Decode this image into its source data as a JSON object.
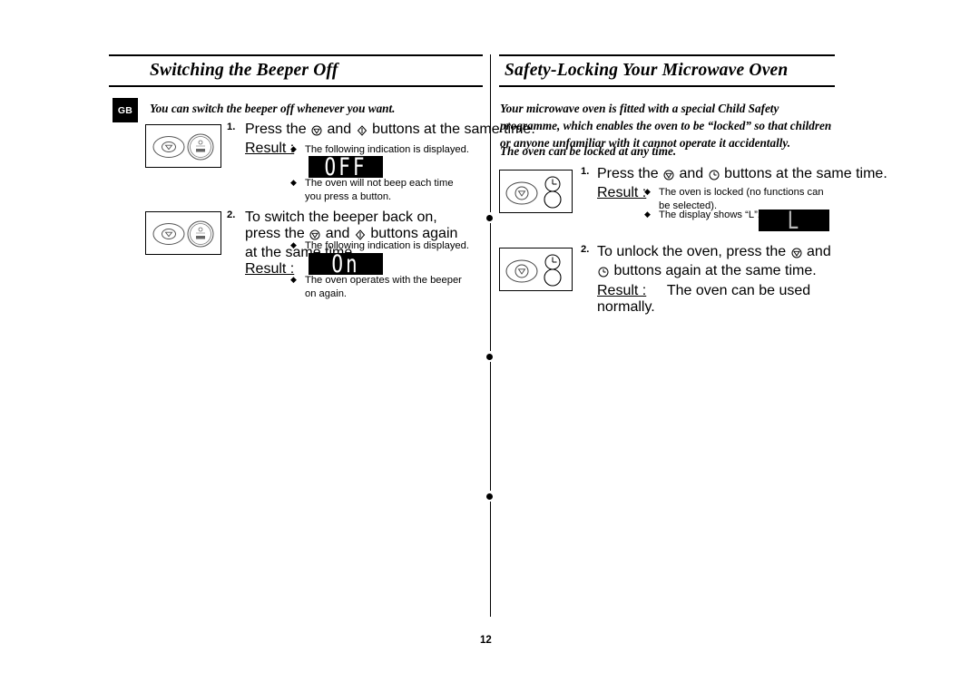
{
  "document": {
    "language_badge": "GB",
    "page_number": "12"
  },
  "left_column": {
    "title": "Switching the Beeper Off",
    "intro": "You can switch the beeper off whenever you want.",
    "steps": [
      {
        "number": "1.",
        "text_before_icon_1": "Press the",
        "icon_1": "microwave-dial-icon",
        "text_between_icons": "and",
        "icon_2": "power-level-icon",
        "text_after_icon_2": "buttons at the same time.",
        "result_label": "Result :",
        "bullets": [
          {
            "mark": "◆",
            "text": "The following indication is displayed."
          },
          {
            "mark": "◆",
            "text": "The oven will not beep each time you press a button."
          }
        ],
        "display": {
          "value": "OFF",
          "name": "lcd-display-off"
        }
      },
      {
        "number": "2.",
        "text_before_icon_1": "To switch the beeper back on, press the",
        "icon_1": "microwave-dial-icon",
        "text_between_icons": "and",
        "icon_2": "power-level-icon",
        "text_after_icon_2": "buttons again at the same time.",
        "result_label": "Result :",
        "bullets": [
          {
            "mark": "◆",
            "text": "The following indication is displayed."
          },
          {
            "mark": "◆",
            "text": "The oven operates with the beeper on again."
          }
        ],
        "display": {
          "value": "On",
          "name": "lcd-display-on"
        }
      }
    ]
  },
  "right_column": {
    "title": "Safety-Locking Your Microwave Oven",
    "intro_1": "Your microwave oven is fitted with a special Child Safety programme, which enables the oven to be “locked” so that children or anyone unfamiliar with it cannot operate it accidentally.",
    "intro_2": "The oven can be locked at any time.",
    "steps": [
      {
        "number": "1.",
        "text_before_icon_1": "Press the",
        "icon_1": "microwave-dial-icon",
        "text_between_icons": "and",
        "icon_2": "clock-icon",
        "text_after_icon_2": "buttons at the same time.",
        "result_label": "Result :",
        "bullets": [
          {
            "mark": "◆",
            "text": "The oven is locked (no functions can be selected)."
          },
          {
            "mark": "◆",
            "text": "The display shows “L”."
          }
        ],
        "display": {
          "value": "L",
          "name": "lcd-display-locked"
        }
      },
      {
        "number": "2.",
        "text_before_icon_1": "To unlock the oven, press the",
        "icon_1": "microwave-dial-icon",
        "text_between_icons": "and",
        "icon_2": "clock-icon",
        "text_after_icon_2": "buttons again at the same time.",
        "result_label": "Result :",
        "result_text": "The oven can be used normally."
      }
    ]
  },
  "colors": {
    "text": "#000000",
    "background": "#ffffff",
    "lcd_background": "#000000",
    "lcd_text": "#ffffff",
    "lcd_dim_text": "#b9b9b9"
  }
}
